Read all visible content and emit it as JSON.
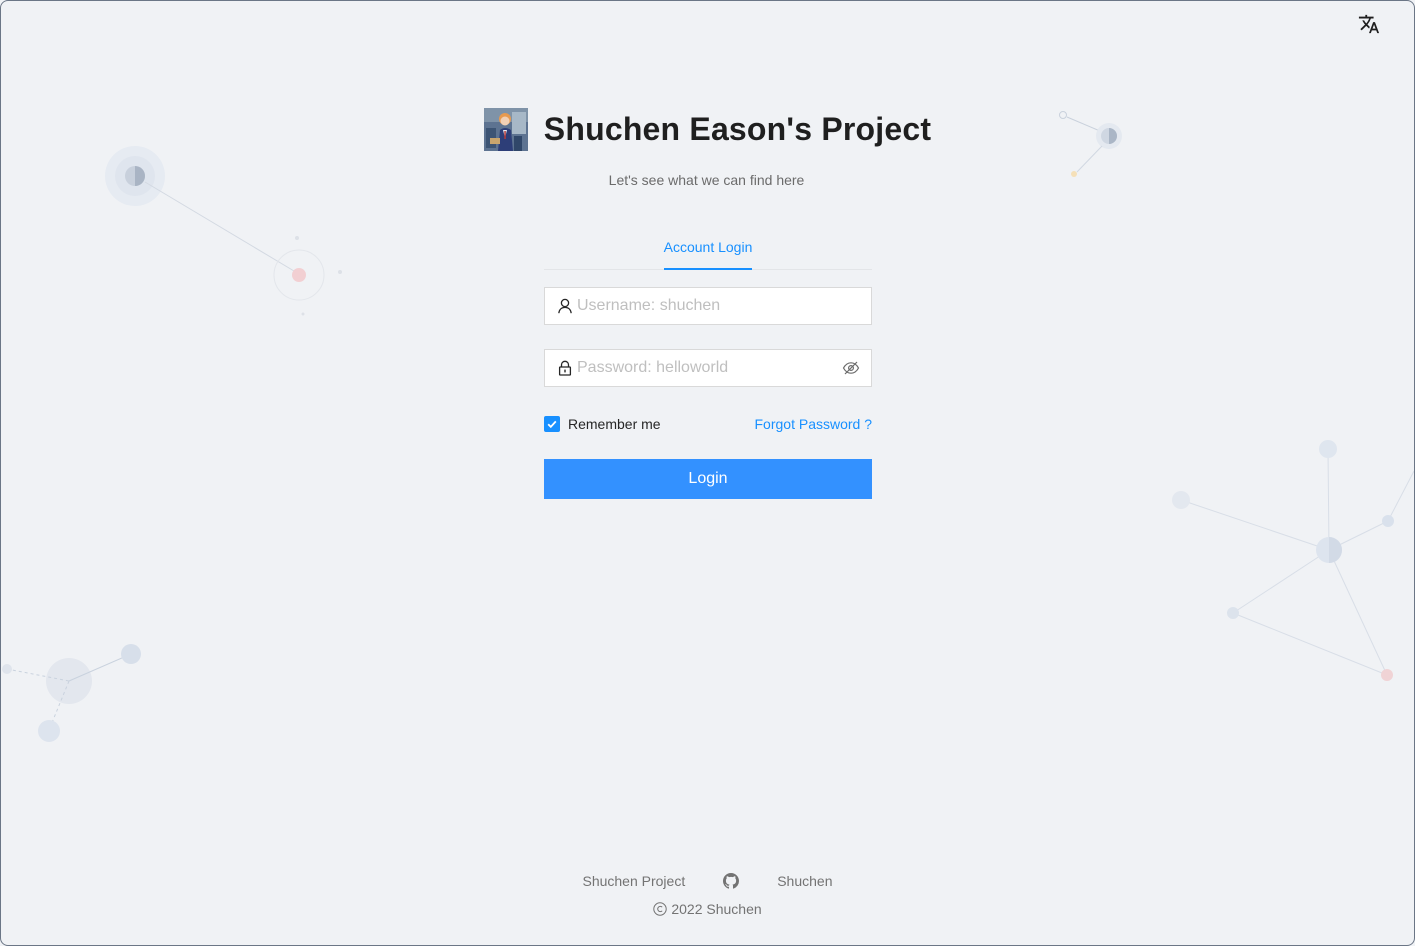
{
  "header": {
    "title": "Shuchen Eason's Project",
    "subtitle": "Let's see what we can find here"
  },
  "tabs": [
    {
      "label": "Account Login",
      "active": true
    }
  ],
  "form": {
    "username_placeholder": "Username: shuchen",
    "password_placeholder": "Password: helloworld",
    "remember_label": "Remember me",
    "remember_checked": true,
    "forgot_label": "Forgot Password ?",
    "login_label": "Login"
  },
  "footer": {
    "links": [
      "Shuchen Project",
      "Shuchen"
    ],
    "copyright": "2022 Shuchen"
  },
  "colors": {
    "accent": "#1890ff",
    "button": "#3391ff",
    "background": "#f0f2f5"
  },
  "icons": {
    "language": "translate-icon",
    "user": "user-icon",
    "lock": "lock-icon",
    "visibility": "eye-invisible-icon",
    "github": "github-icon",
    "copyright": "copyright-icon"
  }
}
